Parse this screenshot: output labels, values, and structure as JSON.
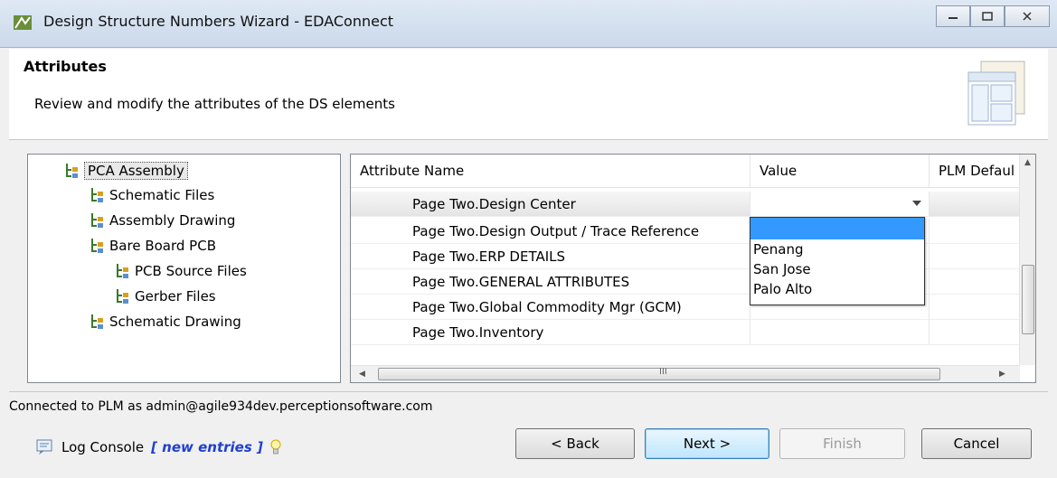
{
  "window": {
    "title": "Design Structure Numbers Wizard - EDAConnect",
    "icon": "eda-connect-icon",
    "controls": {
      "minimize": "minimize-icon",
      "maximize": "maximize-icon",
      "close": "close-icon"
    }
  },
  "header": {
    "title": "Attributes",
    "description": "Review and modify the attributes of the DS elements",
    "graphic": "window-layout-icon"
  },
  "tree": {
    "items": [
      {
        "label": "PCA Assembly",
        "selected": true
      },
      {
        "label": "Schematic Files"
      },
      {
        "label": "Assembly Drawing"
      },
      {
        "label": "Bare Board PCB"
      },
      {
        "label": "PCB Source Files"
      },
      {
        "label": "Gerber Files"
      },
      {
        "label": "Schematic Drawing"
      }
    ]
  },
  "table": {
    "columns": [
      "Attribute Name",
      "Value",
      "PLM Defaul"
    ],
    "rows": [
      {
        "name": "Page Two.Design Center",
        "value": ""
      },
      {
        "name": "Page Two.Design Output / Trace Reference",
        "value": ""
      },
      {
        "name": "Page Two.ERP DETAILS",
        "value": ""
      },
      {
        "name": "Page Two.GENERAL ATTRIBUTES",
        "value": ""
      },
      {
        "name": "Page Two.Global Commodity Mgr (GCM)",
        "value": ""
      },
      {
        "name": "Page Two.Inventory",
        "value": ""
      }
    ],
    "dropdown_options": [
      "",
      "Penang",
      "San Jose",
      "Palo Alto"
    ],
    "hscroll_grip": "III"
  },
  "status": {
    "connection": "Connected to PLM as admin@agile934dev.perceptionsoftware.com"
  },
  "log": {
    "label": "Log Console",
    "new_entries": "[ new entries ]"
  },
  "buttons": {
    "back": "< Back",
    "next": "Next >",
    "finish": "Finish",
    "cancel": "Cancel"
  },
  "colors": {
    "selection": "#3399ff",
    "link": "#1f3fd0"
  }
}
